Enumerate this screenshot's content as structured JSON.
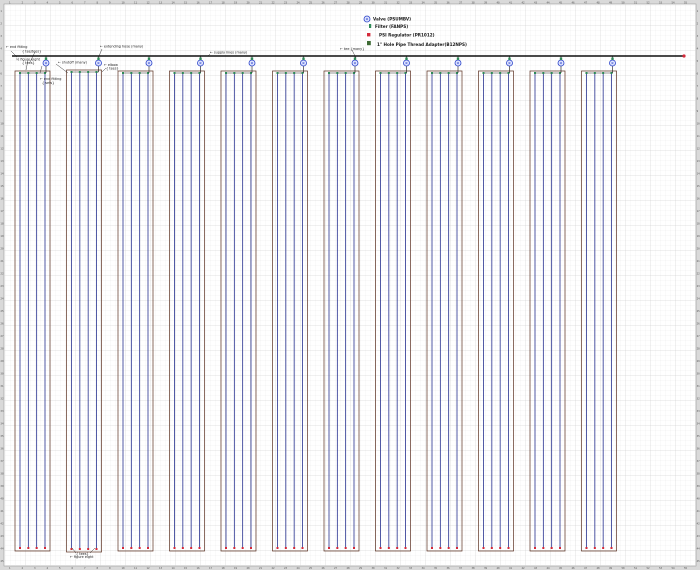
{
  "legend": {
    "valve": "Valve (PSUMBV)",
    "filter": "Filter (FANPS)",
    "regulator": "PSI Regulator (PR1012)",
    "adapter": "1\" Hole Pipe Thread Adapter(B12NPS)"
  },
  "annotations": {
    "end_fitting_top": "← end fitting",
    "tee_left": "{ tee/tees}",
    "figure_eight": "½ figure eight",
    "figure_eight_sub": "{ tees}",
    "end_fitting_mid": "← end fitting",
    "end_fitting_mid_sub": "{ sets}",
    "shutoff": "← shutoff (many)",
    "extending": "← extending hose (many)",
    "elbow": "← elbow",
    "elbow_sub": "{ tees}",
    "supply": "← supply lines (many)",
    "tee_right": "← tee {many}",
    "bottom_fig": "← figure eight",
    "bottom_fig_sub": "{ tees}"
  },
  "zones": {
    "count": 12,
    "lines_per_zone": 4
  },
  "colors": {
    "background": "#ffffff",
    "grid_minor": "#e2e2e2",
    "grid_major": "#c9c9c9",
    "supply_line": "#111111",
    "drip_line": "#26308f",
    "bed_outline": "#5a2e1f",
    "valve": "#2a43c9",
    "filter": "#2e8b57",
    "regulator": "#d42a3a",
    "adapter": "#3e6b34"
  }
}
